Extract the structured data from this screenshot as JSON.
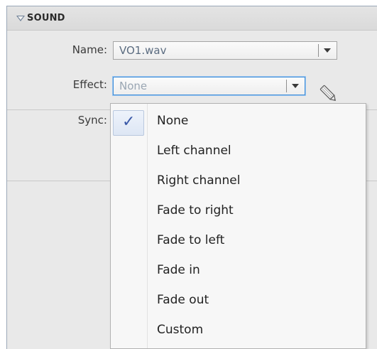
{
  "section": {
    "title": "SOUND"
  },
  "name_field": {
    "label": "Name:",
    "value": "VO1.wav"
  },
  "effect_field": {
    "label": "Effect:",
    "value": "None"
  },
  "sync_field": {
    "label": "Sync:"
  },
  "effect_menu": {
    "selected": "None",
    "items": [
      {
        "label": "None"
      },
      {
        "label": "Left channel"
      },
      {
        "label": "Right channel"
      },
      {
        "label": "Fade to right"
      },
      {
        "label": "Fade to left"
      },
      {
        "label": "Fade in"
      },
      {
        "label": "Fade out"
      },
      {
        "label": "Custom"
      }
    ]
  },
  "icons": {
    "collapse": "triangle-down-icon",
    "dropdown": "chevron-down-icon",
    "edit": "pencil-icon",
    "check": "checkmark-icon"
  },
  "colors": {
    "panel_bg": "#e9e9e9",
    "focus_border": "#3f8dd8",
    "check_color": "#3a59a8"
  }
}
